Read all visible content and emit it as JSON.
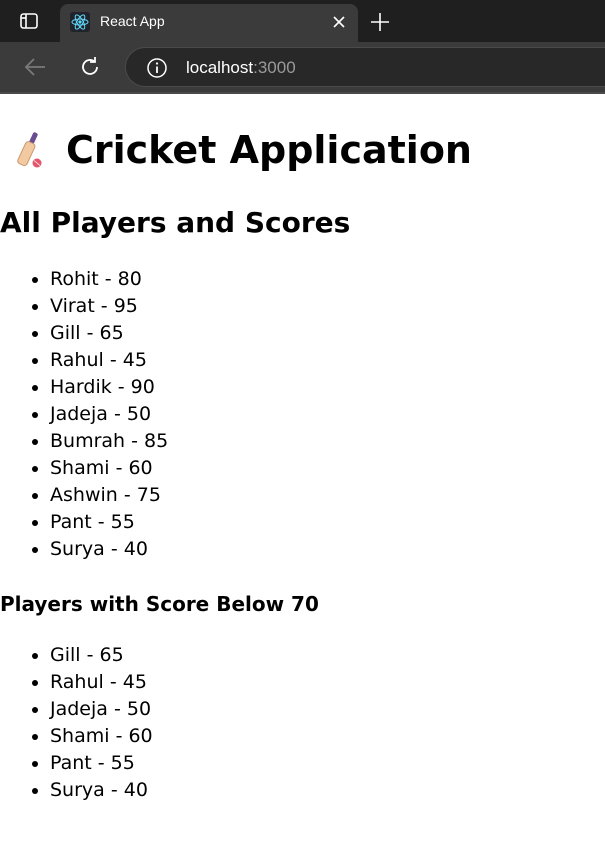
{
  "browser": {
    "tab_title": "React App",
    "url_host": "localhost",
    "url_port": ":3000"
  },
  "app": {
    "title": "Cricket Application",
    "all_section": {
      "title": "All Players and Scores",
      "players": [
        "Rohit - 80",
        "Virat - 95",
        "Gill - 65",
        "Rahul - 45",
        "Hardik - 90",
        "Jadeja - 50",
        "Bumrah - 85",
        "Shami - 60",
        "Ashwin - 75",
        "Pant - 55",
        "Surya - 40"
      ]
    },
    "below_section": {
      "title": "Players with Score Below 70",
      "players": [
        "Gill - 65",
        "Rahul - 45",
        "Jadeja - 50",
        "Shami - 60",
        "Pant - 55",
        "Surya - 40"
      ]
    }
  },
  "icons": {
    "tab_actions": "tab-actions-icon",
    "favicon": "react-logo-icon",
    "close": "close-icon",
    "new_tab": "plus-icon",
    "back": "back-arrow-icon",
    "reload": "reload-icon",
    "site_info": "info-icon",
    "title_emoji": "cricket-bat-icon"
  },
  "colors": {
    "chrome_dark": "#1f1f1f",
    "chrome_tab": "#3b3b3b",
    "react_blue": "#61dafb",
    "bat_wood": "#f2c9a0",
    "bat_handle": "#6a4c93",
    "ball_red": "#e3566b"
  }
}
